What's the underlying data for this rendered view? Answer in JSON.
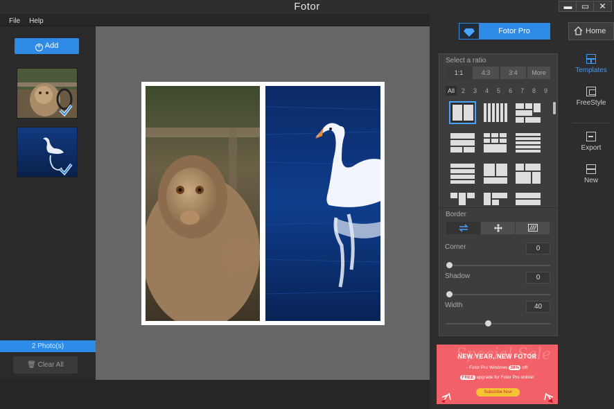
{
  "app": {
    "title": "Fotor"
  },
  "window_controls": {
    "minimize": "▬",
    "maximize": "▭",
    "close": "✕"
  },
  "menu": {
    "file": "File",
    "help": "Help"
  },
  "left_panel": {
    "add_label": "Add",
    "photo_count": "2 Photo(s)",
    "clear_all": "Clear All"
  },
  "top_right": {
    "fotor_pro": "Fotor Pro",
    "home": "Home"
  },
  "ratio": {
    "title": "Select a ratio",
    "options": [
      "1:1",
      "4:3",
      "3:4",
      "More"
    ],
    "selected": "1:1"
  },
  "template_counts": [
    "All",
    "2",
    "3",
    "4",
    "5",
    "6",
    "7",
    "8",
    "9"
  ],
  "border": {
    "title": "Border",
    "corner_label": "Corner",
    "corner_value": "0",
    "shadow_label": "Shadow",
    "shadow_value": "0",
    "width_label": "Width",
    "width_value": "40",
    "width_level_fraction": 0.4
  },
  "nav": {
    "templates": "Templates",
    "freestyle": "FreeStyle",
    "export": "Export",
    "new": "New"
  },
  "ad": {
    "script_text": "Special Sale",
    "headline": "NEW YEAR, NEW FOTOR",
    "line1_pre": "· Fotor Pro Windows",
    "line1_badge": "30%",
    "line1_post": "off!",
    "line2_badge": "FREE",
    "line2_post": "upgrade for Fotor Pro online!",
    "cta": "Subscribe Now"
  },
  "colors": {
    "accent": "#2f8ae5",
    "ad_bg": "#f26167"
  }
}
